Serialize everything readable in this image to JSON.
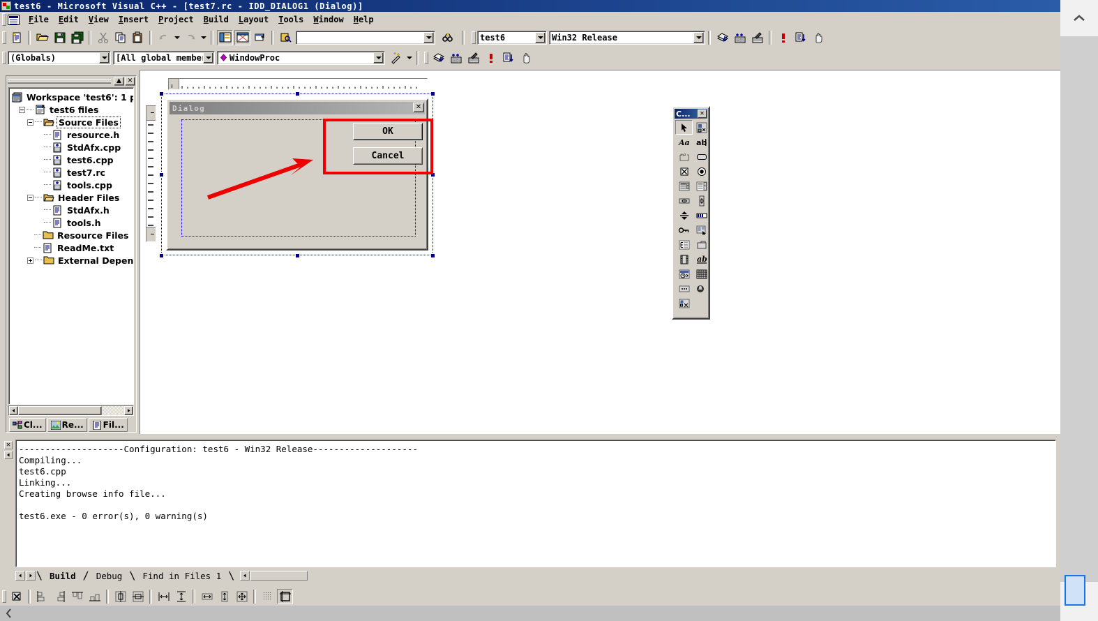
{
  "window": {
    "title": "test6 - Microsoft Visual C++ - [test7.rc - IDD_DIALOG1 (Dialog)]",
    "app_icon": "vcpp-icon"
  },
  "menu": {
    "items": [
      {
        "label": "File"
      },
      {
        "label": "Edit"
      },
      {
        "label": "View"
      },
      {
        "label": "Insert"
      },
      {
        "label": "Project"
      },
      {
        "label": "Build"
      },
      {
        "label": "Layout"
      },
      {
        "label": "Tools"
      },
      {
        "label": "Window"
      },
      {
        "label": "Help"
      }
    ]
  },
  "standard_toolbar": {
    "buttons": [
      {
        "name": "new-file-button",
        "icon": "new-document-icon"
      },
      {
        "name": "open-file-button",
        "icon": "open-folder-icon"
      },
      {
        "name": "save-button",
        "icon": "floppy-disk-icon"
      },
      {
        "name": "save-all-button",
        "icon": "save-all-icon"
      },
      {
        "name": "cut-button",
        "icon": "scissors-icon"
      },
      {
        "name": "copy-button",
        "icon": "copy-icon"
      },
      {
        "name": "paste-button",
        "icon": "clipboard-paste-icon"
      },
      {
        "name": "undo-button",
        "icon": "undo-arrow-icon"
      },
      {
        "name": "redo-button",
        "icon": "redo-arrow-icon"
      },
      {
        "name": "workspace-toggle-button",
        "icon": "workspace-window-icon"
      },
      {
        "name": "output-toggle-button",
        "icon": "output-window-icon"
      },
      {
        "name": "window-list-button",
        "icon": "window-list-icon"
      },
      {
        "name": "find-in-files-button",
        "icon": "binoculars-files-icon"
      },
      {
        "name": "find-button",
        "icon": "binoculars-icon"
      }
    ],
    "find_combo": {
      "value": "",
      "placeholder": ""
    }
  },
  "wizardbar": {
    "class_combo": {
      "value": "(Globals)"
    },
    "members_combo": {
      "value": "[All global members"
    },
    "function_combo": {
      "value": "WindowProc",
      "icon": "magenta-diamond-icon"
    },
    "actions_button": {
      "name": "wizardbar-actions-button",
      "icon": "magic-wand-icon"
    },
    "buttons": [
      {
        "name": "compile-button",
        "icon": "compile-icon"
      },
      {
        "name": "build-button",
        "icon": "build-bricks-icon"
      },
      {
        "name": "stop-build-button",
        "icon": "stop-build-icon"
      },
      {
        "name": "execute-program-button",
        "icon": "red-exclamation-icon"
      },
      {
        "name": "go-button",
        "icon": "debug-go-icon"
      },
      {
        "name": "insert-breakpoint-button",
        "icon": "hand-icon"
      }
    ]
  },
  "build_toolbar": {
    "project_combo": {
      "value": "test6"
    },
    "config_combo": {
      "value": "Win32 Release"
    },
    "buttons": [
      {
        "name": "compile-button",
        "icon": "compile-icon"
      },
      {
        "name": "build-button",
        "icon": "build-bricks-icon"
      },
      {
        "name": "stop-build-button",
        "icon": "stop-build-icon"
      },
      {
        "name": "execute-program-button",
        "icon": "red-exclamation-icon"
      },
      {
        "name": "go-button",
        "icon": "debug-go-icon"
      },
      {
        "name": "insert-breakpoint-button",
        "icon": "hand-icon"
      }
    ]
  },
  "workspace": {
    "panel_title": "",
    "minimize_label": "▲",
    "close_label": "✕",
    "tree": [
      {
        "label": "Workspace 'test6': 1 p",
        "depth": 0,
        "icon": "workspace-icon",
        "toggle": "none",
        "selected": false
      },
      {
        "label": "test6 files",
        "depth": 1,
        "icon": "project-icon",
        "toggle": "minus",
        "selected": false
      },
      {
        "label": "Source Files",
        "depth": 2,
        "icon": "open-folder-icon",
        "toggle": "minus",
        "selected": true
      },
      {
        "label": "resource.h",
        "depth": 3,
        "icon": "header-file-icon",
        "toggle": "none",
        "selected": false
      },
      {
        "label": "StdAfx.cpp",
        "depth": 3,
        "icon": "cpp-file-icon",
        "toggle": "none",
        "selected": false
      },
      {
        "label": "test6.cpp",
        "depth": 3,
        "icon": "cpp-file-icon",
        "toggle": "none",
        "selected": false
      },
      {
        "label": "test7.rc",
        "depth": 3,
        "icon": "cpp-file-icon",
        "toggle": "none",
        "selected": false
      },
      {
        "label": "tools.cpp",
        "depth": 3,
        "icon": "cpp-file-icon",
        "toggle": "none",
        "selected": false
      },
      {
        "label": "Header Files",
        "depth": 2,
        "icon": "open-folder-icon",
        "toggle": "minus",
        "selected": false
      },
      {
        "label": "StdAfx.h",
        "depth": 3,
        "icon": "header-file-icon",
        "toggle": "none",
        "selected": false
      },
      {
        "label": "tools.h",
        "depth": 3,
        "icon": "header-file-icon",
        "toggle": "none",
        "selected": false
      },
      {
        "label": "Resource Files",
        "depth": 2,
        "icon": "closed-folder-icon",
        "toggle": "none",
        "selected": false
      },
      {
        "label": "ReadMe.txt",
        "depth": 2,
        "icon": "text-file-icon",
        "toggle": "none",
        "selected": false
      },
      {
        "label": "External Depend",
        "depth": 2,
        "icon": "closed-folder-icon",
        "toggle": "plus",
        "selected": false
      }
    ],
    "tabs": [
      {
        "label": "Cl...",
        "icon": "classview-icon",
        "active": false
      },
      {
        "label": "Re...",
        "icon": "resourceview-icon",
        "active": false
      },
      {
        "label": "Fil...",
        "icon": "fileview-icon",
        "active": false
      }
    ]
  },
  "dialog_editor": {
    "dialog_caption": "Dialog",
    "close_label": "✕",
    "controls": [
      {
        "label": "OK",
        "name": "ok-button",
        "default": true
      },
      {
        "label": "Cancel",
        "name": "cancel-button",
        "default": false
      }
    ]
  },
  "annotation": {
    "highlight_color": "#ee0000",
    "arrow_color": "#ee0000"
  },
  "toolbox": {
    "title": "C...",
    "close_label": "✕",
    "items": [
      {
        "name": "select-pointer-tool",
        "icon": "arrow-pointer-icon",
        "selected": true
      },
      {
        "name": "custom-control-tool",
        "icon": "custom-control-icon",
        "selected": false
      },
      {
        "name": "static-text-tool",
        "icon": "static-text-Aa-icon",
        "selected": false
      },
      {
        "name": "edit-box-tool",
        "icon": "edit-box-abl-icon",
        "selected": false
      },
      {
        "name": "group-box-tool",
        "icon": "group-box-xyz-icon",
        "selected": false
      },
      {
        "name": "push-button-tool",
        "icon": "push-button-icon",
        "selected": false
      },
      {
        "name": "check-box-tool",
        "icon": "check-box-icon",
        "selected": false
      },
      {
        "name": "radio-button-tool",
        "icon": "radio-button-icon",
        "selected": false
      },
      {
        "name": "combo-box-tool",
        "icon": "combo-box-icon",
        "selected": false
      },
      {
        "name": "list-box-tool",
        "icon": "list-box-icon",
        "selected": false
      },
      {
        "name": "horizontal-scrollbar-tool",
        "icon": "horizontal-scrollbar-icon",
        "selected": false
      },
      {
        "name": "vertical-scrollbar-tool",
        "icon": "vertical-scrollbar-icon",
        "selected": false
      },
      {
        "name": "spin-control-tool",
        "icon": "spin-control-icon",
        "selected": false
      },
      {
        "name": "progress-bar-tool",
        "icon": "progress-bar-icon",
        "selected": false
      },
      {
        "name": "slider-tool",
        "icon": "slider-icon",
        "selected": false
      },
      {
        "name": "hotkey-tool",
        "icon": "hotkey-icon",
        "selected": false
      },
      {
        "name": "list-control-tool",
        "icon": "list-control-icon",
        "selected": false
      },
      {
        "name": "tree-control-tool",
        "icon": "tree-control-icon",
        "selected": false
      },
      {
        "name": "tab-control-tool",
        "icon": "tab-control-icon",
        "selected": false
      },
      {
        "name": "animate-control-tool",
        "icon": "animate-film-icon",
        "selected": false
      },
      {
        "name": "rich-edit-tool",
        "icon": "rich-edit-ab-icon",
        "selected": false
      },
      {
        "name": "date-time-picker-tool",
        "icon": "date-time-picker-icon",
        "selected": false
      },
      {
        "name": "month-calendar-tool",
        "icon": "month-calendar-icon",
        "selected": false
      },
      {
        "name": "ip-address-tool",
        "icon": "ip-address-icon",
        "selected": false
      },
      {
        "name": "extended-combo-tool",
        "icon": "extended-combo-icon",
        "selected": false
      },
      {
        "name": "custom-control2-tool",
        "icon": "custom-control2-icon",
        "selected": false
      }
    ]
  },
  "output": {
    "close_label": "✕",
    "text": "--------------------Configuration: test6 - Win32 Release--------------------\nCompiling...\ntest6.cpp\nLinking...\nCreating browse info file...\n\ntest6.exe - 0 error(s), 0 warning(s)",
    "tabs": [
      {
        "label": "Build",
        "active": true
      },
      {
        "label": "Debug",
        "active": false
      },
      {
        "label": "Find in Files 1",
        "active": false
      }
    ]
  },
  "layout_toolbar": {
    "buttons": [
      {
        "name": "test-dialog-button",
        "icon": "test-dialog-icon"
      },
      {
        "name": "align-left-button",
        "icon": "align-left-icon"
      },
      {
        "name": "align-right-button",
        "icon": "align-right-icon"
      },
      {
        "name": "align-top-button",
        "icon": "align-top-icon"
      },
      {
        "name": "align-bottom-button",
        "icon": "align-bottom-icon"
      },
      {
        "name": "center-vertical-button",
        "icon": "center-vertical-icon"
      },
      {
        "name": "center-horizontal-button",
        "icon": "center-horizontal-icon"
      },
      {
        "name": "space-across-button",
        "icon": "space-across-icon"
      },
      {
        "name": "space-down-button",
        "icon": "space-down-icon"
      },
      {
        "name": "make-same-width-button",
        "icon": "same-width-icon"
      },
      {
        "name": "make-same-height-button",
        "icon": "same-height-icon"
      },
      {
        "name": "make-same-size-button",
        "icon": "same-size-icon"
      },
      {
        "name": "toggle-grid-button",
        "icon": "toggle-grid-icon"
      },
      {
        "name": "toggle-guides-button",
        "icon": "toggle-guides-icon"
      }
    ]
  }
}
